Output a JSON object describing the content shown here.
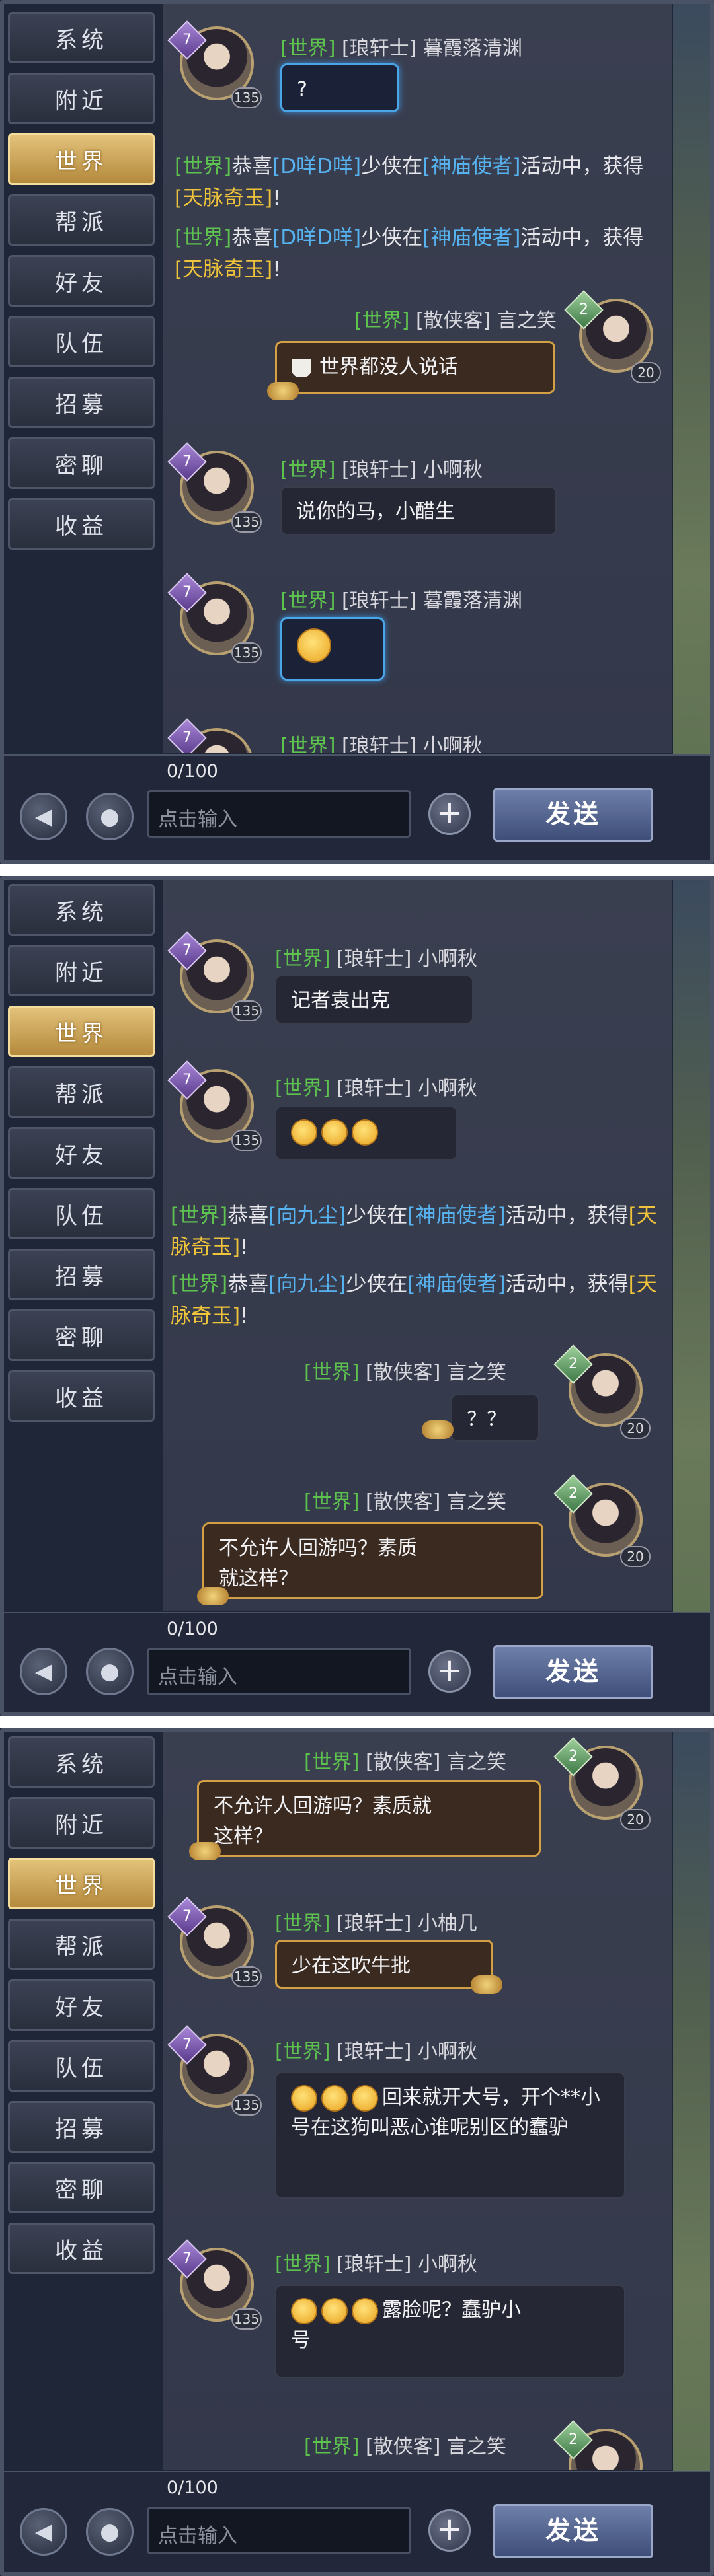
{
  "sidebar": {
    "items": [
      {
        "label": "系统"
      },
      {
        "label": "附近"
      },
      {
        "label": "世界"
      },
      {
        "label": "帮派"
      },
      {
        "label": "好友"
      },
      {
        "label": "队伍"
      },
      {
        "label": "招募"
      },
      {
        "label": "密聊"
      },
      {
        "label": "收益"
      }
    ],
    "active_index": 2
  },
  "input": {
    "count": "0/100",
    "placeholder": "点击输入",
    "send_label": "发送",
    "plus_symbol": "+"
  },
  "colors": {
    "channel": "#5ec24f",
    "player": "#57b3f0",
    "item": "#f0c43a",
    "gold_border": "#d4a045",
    "send_button": "#4e5f8c"
  },
  "icons": {
    "voice_toggle": "speaker-icon",
    "microphone": "microphone-icon",
    "add": "plus-icon",
    "emoji": "emoji-face-icon",
    "tea": "tea-cup-icon"
  },
  "chat": {
    "channel_tag": "[世界]",
    "sys_prefix": "恭喜",
    "sys_mid": "少侠在",
    "sys_event": "[神庙使者]",
    "sys_suffix": "活动中，获得",
    "sys_item": "[天脉奇玉]",
    "sys_end": "!",
    "panel1": {
      "msg1": {
        "level": "7",
        "vip": "135",
        "school": "[琅轩士]",
        "name": "暮霞落清渊",
        "text": "?"
      },
      "sys1_player": "[D咩D咩]",
      "sys2_player": "[D咩D咩]",
      "msg2": {
        "level": "2",
        "vip": "20",
        "school": "[散侠客]",
        "name": "言之笑",
        "text": "世界都没人说话"
      },
      "msg3": {
        "level": "7",
        "vip": "135",
        "school": "[琅轩士]",
        "name": "小啊秋",
        "text": "说你的马，小醋生"
      },
      "msg4": {
        "level": "7",
        "vip": "135",
        "school": "[琅轩士]",
        "name": "暮霞落清渊",
        "text": ""
      },
      "msg5": {
        "level": "7",
        "school": "[琅轩士]",
        "name": "小啊秋"
      }
    },
    "panel2": {
      "msg1": {
        "level": "7",
        "vip": "135",
        "school": "[琅轩士]",
        "name": "小啊秋",
        "text": "记者袁出克"
      },
      "msg2": {
        "level": "7",
        "vip": "135",
        "school": "[琅轩士]",
        "name": "小啊秋",
        "text": ""
      },
      "sys1_player": "[向九尘]",
      "sys2_player": "[向九尘]",
      "msg3": {
        "level": "2",
        "vip": "20",
        "school": "[散侠客]",
        "name": "言之笑",
        "text": "？？"
      },
      "msg4": {
        "level": "2",
        "vip": "20",
        "school": "[散侠客]",
        "name": "言之笑",
        "text": "不允许人回游吗？素质就这样？"
      }
    },
    "panel3": {
      "msg1": {
        "level": "2",
        "vip": "20",
        "school": "[散侠客]",
        "name": "言之笑",
        "text": "不允许人回游吗？素质就这样？"
      },
      "msg2": {
        "level": "7",
        "vip": "135",
        "school": "[琅轩士]",
        "name": "小柚几",
        "text": "少在这吹牛批"
      },
      "msg3": {
        "level": "7",
        "vip": "135",
        "school": "[琅轩士]",
        "name": "小啊秋",
        "text": "回来就开大号，开个**小号在这狗叫恶心谁呢别区的蠢驴"
      },
      "msg4": {
        "level": "7",
        "vip": "135",
        "school": "[琅轩士]",
        "name": "小啊秋",
        "text": "露脸呢？蠢驴小号"
      },
      "msg5": {
        "level": "2",
        "school": "[散侠客]",
        "name": "言之笑"
      }
    }
  }
}
